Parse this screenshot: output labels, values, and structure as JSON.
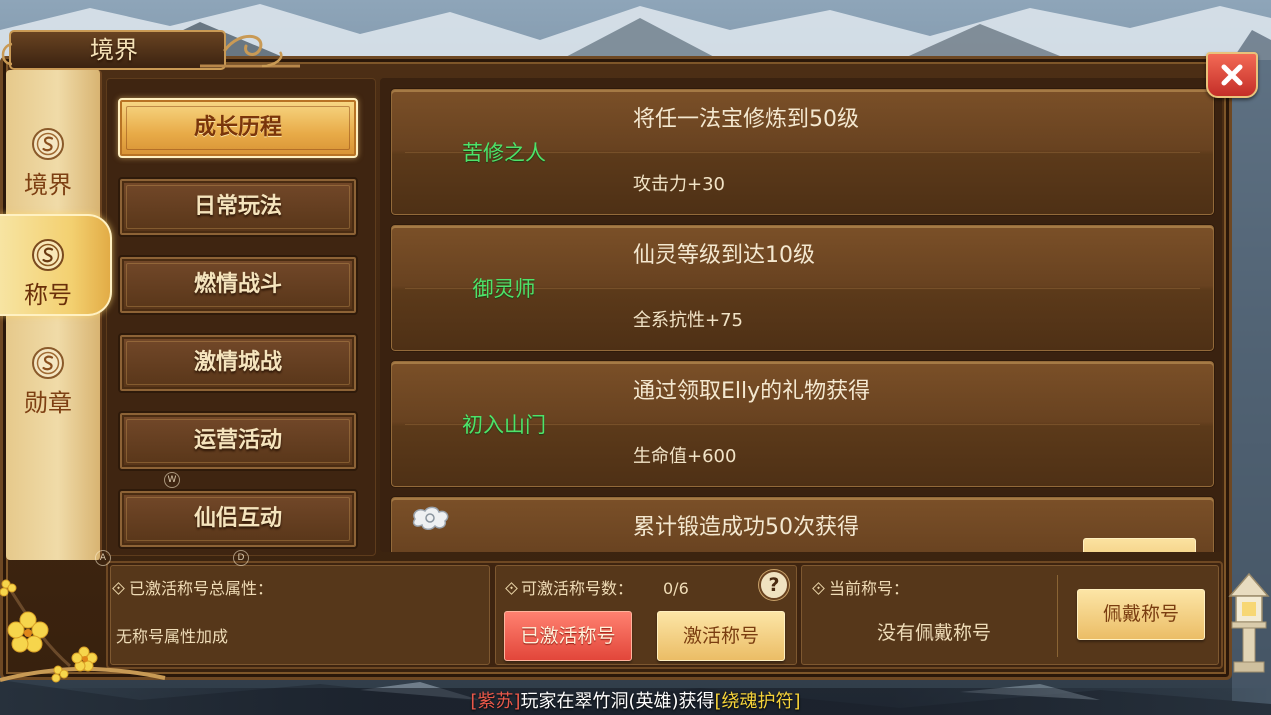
{
  "window": {
    "title": "境界",
    "close_icon": "close-icon"
  },
  "side_tabs": [
    {
      "label": "境界",
      "icon": "emblem-icon",
      "selected": false
    },
    {
      "label": "称号",
      "icon": "emblem-icon",
      "selected": true
    },
    {
      "label": "勋章",
      "icon": "emblem-icon",
      "selected": false
    }
  ],
  "categories": [
    {
      "label": "成长历程",
      "selected": true
    },
    {
      "label": "日常玩法",
      "selected": false
    },
    {
      "label": "燃情战斗",
      "selected": false
    },
    {
      "label": "激情城战",
      "selected": false
    },
    {
      "label": "运营活动",
      "selected": false
    },
    {
      "label": "仙侣互动",
      "selected": false
    }
  ],
  "key_hints": [
    "W",
    "A",
    "D"
  ],
  "titles": [
    {
      "name": "苦修之人",
      "condition": "将任一法宝修炼到50级",
      "bonus": "攻击力+30"
    },
    {
      "name": "御灵师",
      "condition": "仙灵等级到达10级",
      "bonus": "全系抗性+75"
    },
    {
      "name": "初入山门",
      "condition": "通过领取Elly的礼物获得",
      "bonus": "生命值+600"
    },
    {
      "icon": "cloud-ornament-icon",
      "condition": "累计锻造成功50次获得"
    }
  ],
  "summary": {
    "bullet_icon": "diamond-bullet-icon",
    "total_label": "已激活称号总属性：",
    "total_value": "无称号属性加成",
    "activatable_label": "可激活称号数：",
    "activatable_value": "0/6",
    "help_icon": "question-mark-icon",
    "activated_button": "已激活称号",
    "activate_button": "激活称号",
    "current_label": "当前称号：",
    "current_value": "没有佩戴称号",
    "wear_button": "佩戴称号"
  },
  "ticker": {
    "player": "[紫苏]",
    "message": "玩家在翠竹洞(英雄)获得",
    "item": "[绕魂护符]"
  },
  "colors": {
    "title-name": "#4ee26a",
    "gold-button": "#ebbd66",
    "red-button": "#e2463a",
    "tab-cream": "#f0dba8",
    "ticker-player": "#e8584a",
    "ticker-item": "#f5d33a"
  }
}
